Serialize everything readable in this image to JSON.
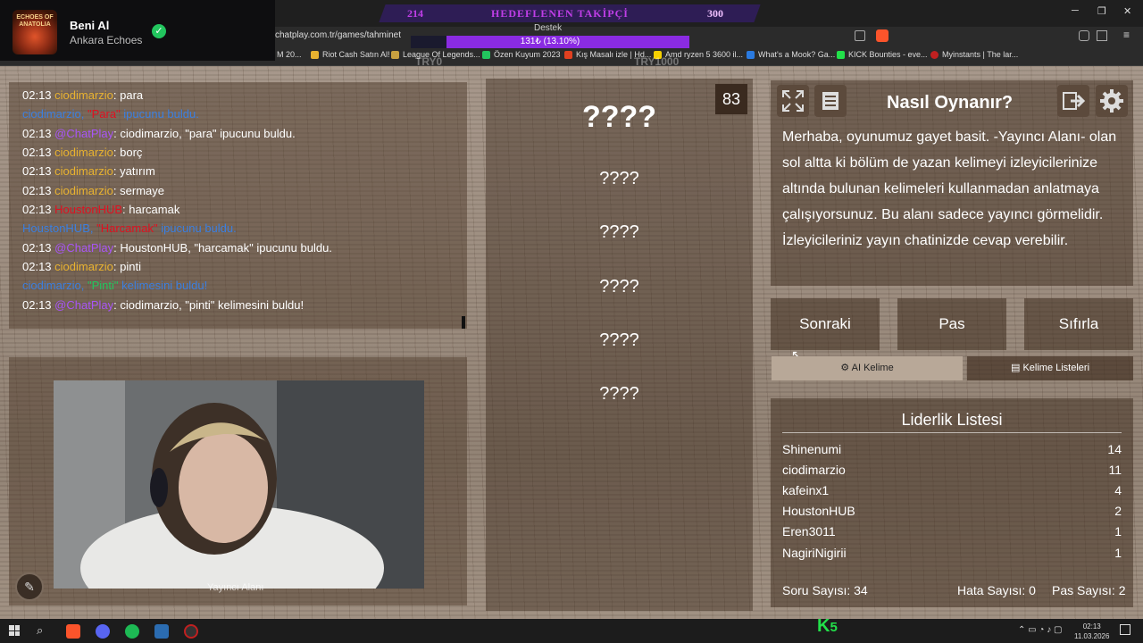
{
  "profile": {
    "name": "Beni Al",
    "subtitle": "Ankara Echoes",
    "logo_text": "ECHOES OF ANATOLIA",
    "check_icon": "check-circle-icon"
  },
  "browser": {
    "url": "chatplay.com.tr/games/tahminet",
    "bookmarks": [
      "M 20...",
      "Riot Cash Satın Al!",
      "League Of Legends...",
      "Özen Kuyum 2023",
      "Kış Masalı izle | Hd...",
      "Amd ryzen 5 3600 il...",
      "What's a Mook? Ga...",
      "KICK Bounties - eve...",
      "Myinstants | The lar..."
    ],
    "controls": {
      "minimize": "─",
      "restore": "❐",
      "close": "✕"
    }
  },
  "overlay": {
    "goal_current": "214",
    "goal_title": "HEDEFLENEN TAKİPÇİ",
    "goal_target": "300",
    "support_label": "Destek",
    "support_text": "131₺ (13.10%)",
    "support_percent": 13.1,
    "try_left": "TRY0",
    "try_right": "TRY1000"
  },
  "chat": {
    "messages": [
      {
        "time": "02:13 ",
        "user": "ciodimarzio",
        "text": ": para",
        "type": "user"
      },
      {
        "text": "ciodimarzio, \"Para\" ipucunu buldu.",
        "type": "system",
        "prefix": "ciodimarzio, ",
        "word": "\"Para\"",
        "suffix": " ipucunu buldu."
      },
      {
        "time": "02:13 ",
        "user": "@ChatPlay",
        "text": ": ciodimarzio, \"para\" ipucunu buldu.",
        "type": "bot"
      },
      {
        "time": "02:13 ",
        "user": "ciodimarzio",
        "text": ": borç",
        "type": "user"
      },
      {
        "time": "02:13 ",
        "user": "ciodimarzio",
        "text": ": yatırım",
        "type": "user"
      },
      {
        "time": "02:13 ",
        "user": "ciodimarzio",
        "text": ": sermaye",
        "type": "user"
      },
      {
        "time": "02:13 ",
        "user": "HoustonHUB",
        "text": ": harcamak",
        "type": "user-red"
      },
      {
        "type": "system",
        "prefix": "HoustonHUB, ",
        "word": "\"Harcamak\"",
        "suffix": " ipucunu buldu."
      },
      {
        "time": "02:13 ",
        "user": "@ChatPlay",
        "text": ": HoustonHUB, \"harcamak\" ipucunu buldu.",
        "type": "bot"
      },
      {
        "time": "02:13 ",
        "user": "ciodimarzio",
        "text": ": pinti",
        "type": "user"
      },
      {
        "type": "system-green",
        "prefix": "ciodimarzio, ",
        "word": "\"Pinti\"",
        "suffix": " kelimesini buldu!"
      },
      {
        "time": "02:13 ",
        "user": "@ChatPlay",
        "text": ": ciodimarzio, \"pinti\" kelimesini buldu!",
        "type": "bot"
      }
    ]
  },
  "camera": {
    "label": "Yayıncı Alanı",
    "pen_icon": "pen-icon"
  },
  "game": {
    "timer": "83",
    "main_word": "????",
    "hints": [
      "????",
      "????",
      "????",
      "????",
      "????"
    ]
  },
  "info": {
    "title": "Nasıl Oynanır?",
    "text": "Merhaba, oyunumuz gayet basit. -Yayıncı Alanı- olan sol altta ki bölüm de yazan kelimeyi izleyicilerinize altında bulunan kelimeleri kullanmadan anlatmaya çalışıyorsunuz. Bu alanı sadece yayıncı görmelidir. İzleyicileriniz yayın chatinizde cevap verebilir.",
    "icons": [
      "fullscreen-icon",
      "list-icon",
      "exit-icon",
      "gear-icon"
    ]
  },
  "actions": {
    "next": "Sonraki",
    "pass": "Pas",
    "reset": "Sıfırla",
    "ai_word": "AI Kelime",
    "word_lists": "Kelime Listeleri"
  },
  "leaderboard": {
    "title": "Liderlik Listesi",
    "rows": [
      {
        "name": "Shinenumi",
        "score": "14"
      },
      {
        "name": "ciodimarzio",
        "score": "11"
      },
      {
        "name": "kafeinx1",
        "score": "4"
      },
      {
        "name": "HoustonHUB",
        "score": "2"
      },
      {
        "name": "Eren3011",
        "score": "1"
      },
      {
        "name": "NagiriNigirii",
        "score": "1"
      }
    ],
    "questions": "Soru Sayısı: 34",
    "errors": "Hata Sayısı: 0",
    "passes": "Pas Sayısı: 2"
  },
  "taskbar": {
    "time": "02:13",
    "date": "11.03.2026",
    "kick_count": "5",
    "kick_logo": "K"
  },
  "colors": {
    "username": "#e8b230",
    "bot": "#a855f7",
    "system": "#3b7fe0",
    "goal": "#c03ee8"
  }
}
